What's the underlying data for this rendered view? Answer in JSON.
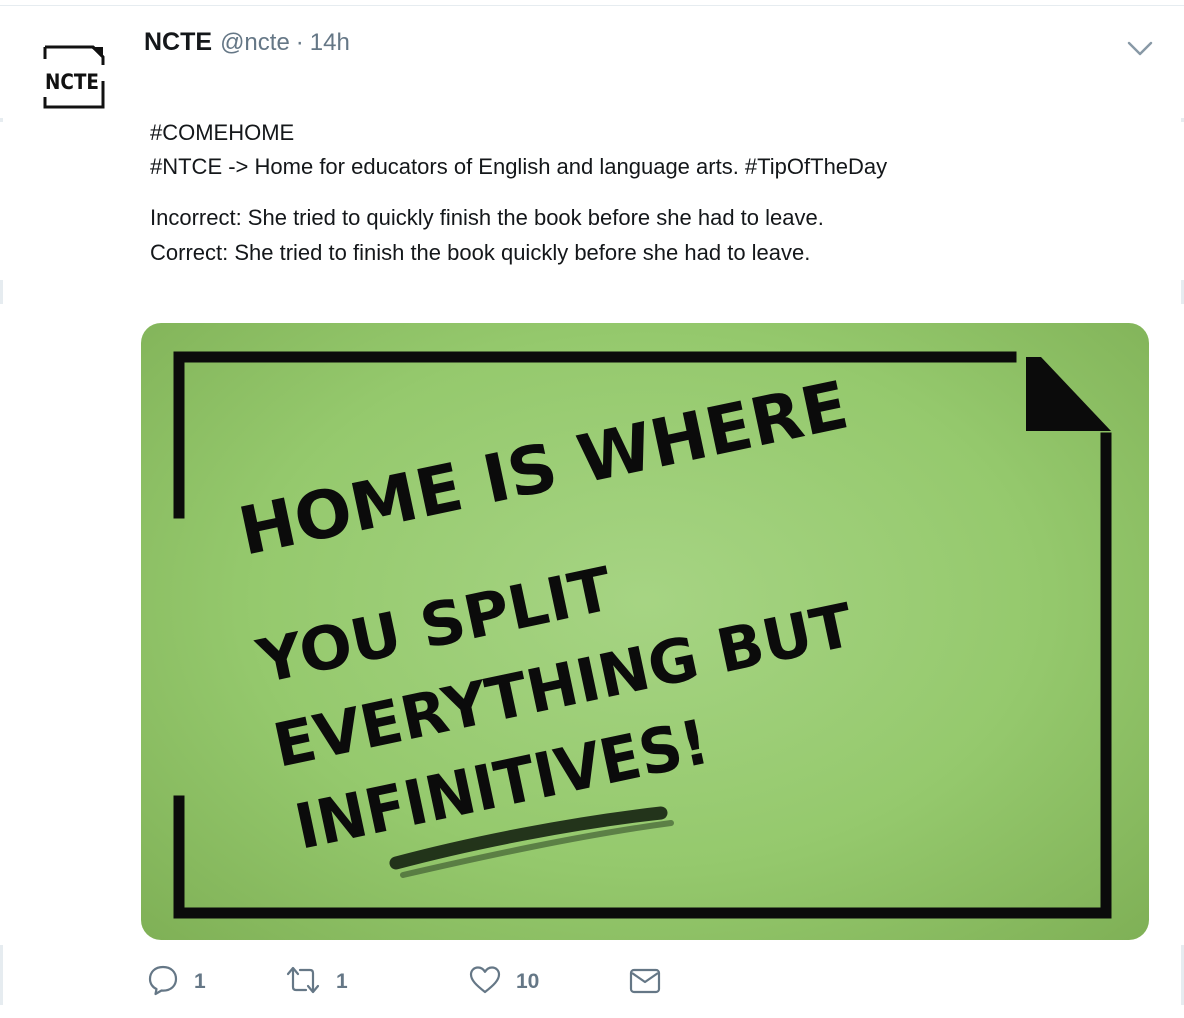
{
  "tweet": {
    "display_name": "NCTE",
    "handle": "@ncte",
    "separator": "·",
    "time": "14h",
    "avatar_text": "NCTE",
    "text_lines": [
      "#COMEHOME",
      "#NTCE -> Home for educators of English and language arts. #TipOfTheDay"
    ],
    "example_lines": [
      "Incorrect: She tried to quickly finish the book before she had to leave.",
      "Correct: She tried to finish the book quickly before she had to leave."
    ],
    "media": {
      "lines": [
        "HOME IS WHERE",
        "YOU SPLIT",
        "EVERYTHING BUT",
        "INFINITIVES!"
      ],
      "background_color": "#95c96d",
      "ink_color": "#0b0b0b"
    }
  },
  "actions": {
    "reply": {
      "icon": "reply-icon",
      "count": "1"
    },
    "retweet": {
      "icon": "retweet-icon",
      "count": "1"
    },
    "like": {
      "icon": "heart-icon",
      "count": "10"
    },
    "message": {
      "icon": "envelope-icon"
    }
  },
  "colors": {
    "text": "#14171a",
    "secondary": "#657786",
    "border": "#e6ecf0"
  }
}
